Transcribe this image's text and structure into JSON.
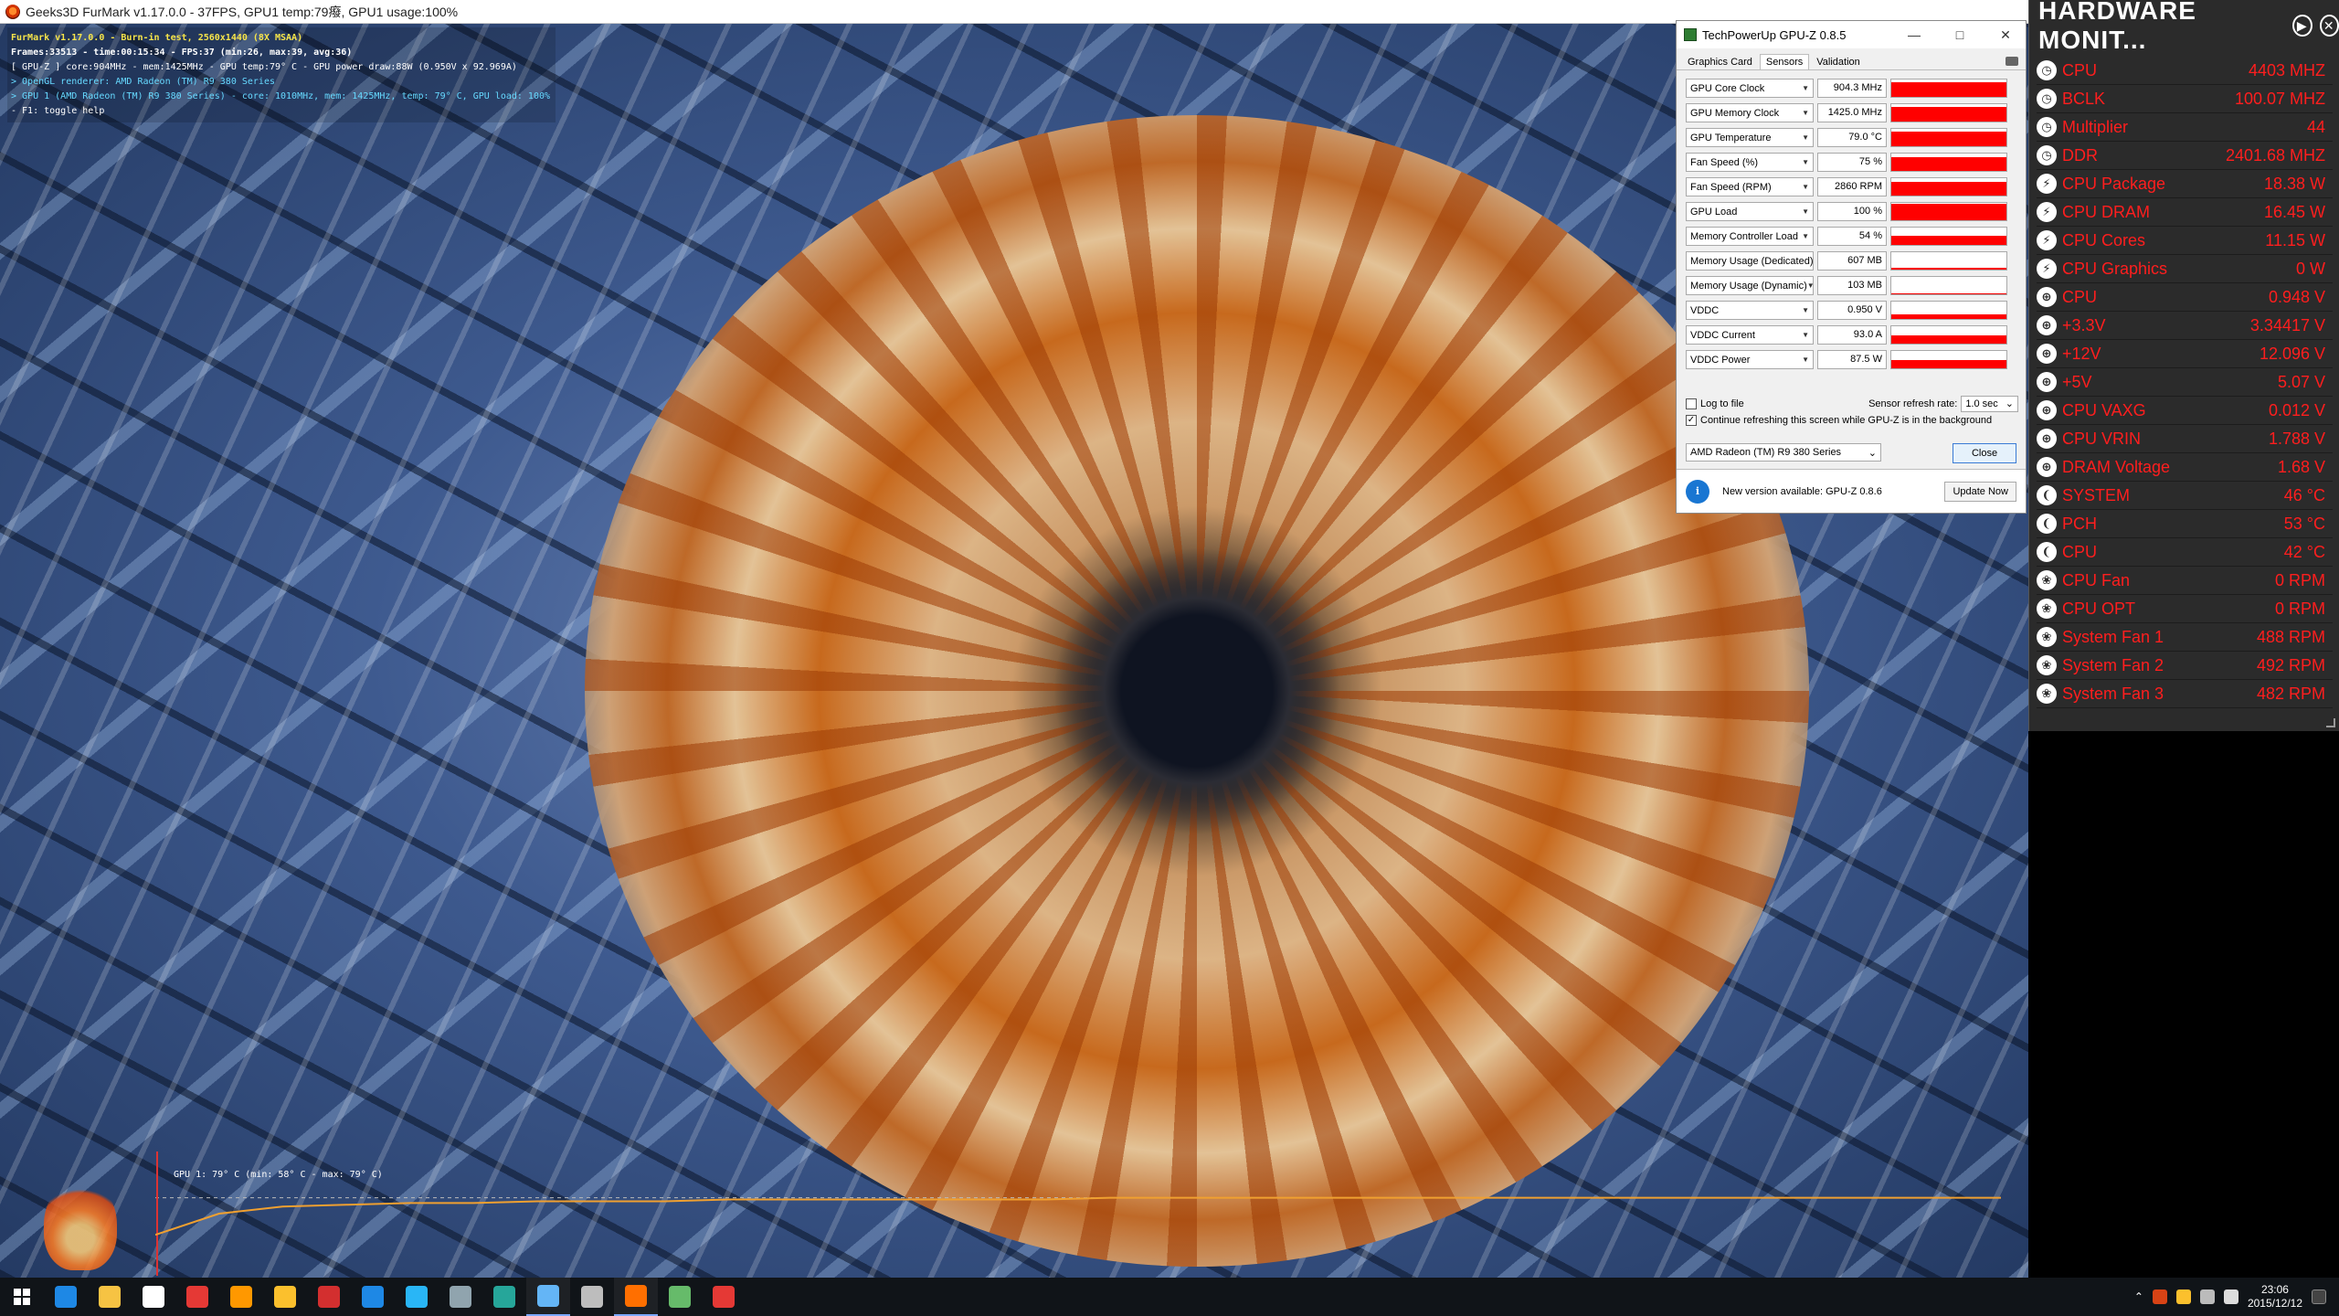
{
  "furmark": {
    "title": "Geeks3D FurMark v1.17.0.0 - 37FPS, GPU1 temp:79癈, GPU1 usage:100%",
    "osd": [
      "FurMark v1.17.0.0 - Burn-in test, 2560x1440 (8X MSAA)",
      "Frames:33513 - time:00:15:34 - FPS:37 (min:26, max:39, avg:36)",
      "[ GPU-Z ] core:904MHz - mem:1425MHz - GPU temp:79° C - GPU power draw:88W (0.950V x 92.969A)",
      "> OpenGL renderer: AMD Radeon (TM) R9 380 Series",
      "> GPU 1 (AMD Radeon (TM) R9 380 Series) - core: 1010MHz, mem: 1425MHz, temp: 79° C, GPU load: 100%",
      "- F1: toggle help"
    ],
    "graph_label": "GPU 1: 79° C (min: 58° C - max: 79° C)",
    "graph_color": "#f0a030",
    "temp_series": [
      58,
      70,
      74,
      75,
      76,
      76,
      77,
      77,
      77,
      78,
      78,
      78,
      78,
      78,
      78,
      79,
      79,
      79,
      79,
      79,
      79,
      79,
      79,
      79,
      79,
      79,
      79,
      79,
      79,
      79
    ]
  },
  "gpuz": {
    "title": "TechPowerUp GPU-Z 0.8.5",
    "tabs": [
      "Graphics Card",
      "Sensors",
      "Validation"
    ],
    "active_tab": "Sensors",
    "sensors": [
      {
        "name": "GPU Core Clock",
        "value": "904.3 MHz",
        "level": 0.85
      },
      {
        "name": "GPU Memory Clock",
        "value": "1425.0 MHz",
        "level": 0.85
      },
      {
        "name": "GPU Temperature",
        "value": "79.0 °C",
        "level": 0.85
      },
      {
        "name": "Fan Speed (%)",
        "value": "75 %",
        "level": 0.8
      },
      {
        "name": "Fan Speed (RPM)",
        "value": "2860 RPM",
        "level": 0.8
      },
      {
        "name": "GPU Load",
        "value": "100 %",
        "level": 0.95
      },
      {
        "name": "Memory Controller Load",
        "value": "54 %",
        "level": 0.55
      },
      {
        "name": "Memory Usage (Dedicated)",
        "value": "607 MB",
        "level": 0.12
      },
      {
        "name": "Memory Usage (Dynamic)",
        "value": "103 MB",
        "level": 0.05
      },
      {
        "name": "VDDC",
        "value": "0.950 V",
        "level": 0.25
      },
      {
        "name": "VDDC Current",
        "value": "93.0 A",
        "level": 0.5
      },
      {
        "name": "VDDC Power",
        "value": "87.5 W",
        "level": 0.5
      }
    ],
    "log_to_file": "Log to file",
    "continue_refresh": "Continue refreshing this screen while GPU-Z is in the background",
    "refresh_label": "Sensor refresh rate:",
    "refresh_value": "1.0 sec",
    "device": "AMD Radeon (TM) R9 380 Series",
    "close_label": "Close",
    "notice": "New version available: GPU-Z 0.8.6",
    "update_label": "Update Now"
  },
  "hwmon": {
    "title": "HARDWARE MONIT...",
    "rows": [
      {
        "label": "CPU",
        "value": "4403 MHZ",
        "icon": "clock"
      },
      {
        "label": "BCLK",
        "value": "100.07 MHZ",
        "icon": "clock"
      },
      {
        "label": "Multiplier",
        "value": "44",
        "icon": "clock"
      },
      {
        "label": "DDR",
        "value": "2401.68 MHZ",
        "icon": "clock"
      },
      {
        "label": "CPU Package",
        "value": "18.38 W",
        "icon": "power"
      },
      {
        "label": "CPU DRAM",
        "value": "16.45 W",
        "icon": "power"
      },
      {
        "label": "CPU Cores",
        "value": "11.15 W",
        "icon": "power"
      },
      {
        "label": "CPU Graphics",
        "value": "0 W",
        "icon": "power"
      },
      {
        "label": "CPU",
        "value": "0.948 V",
        "icon": "voltage"
      },
      {
        "label": "+3.3V",
        "value": "3.34417 V",
        "icon": "voltage"
      },
      {
        "label": "+12V",
        "value": "12.096 V",
        "icon": "voltage"
      },
      {
        "label": "+5V",
        "value": "5.07 V",
        "icon": "voltage"
      },
      {
        "label": "CPU VAXG",
        "value": "0.012 V",
        "icon": "voltage"
      },
      {
        "label": "CPU VRIN",
        "value": "1.788 V",
        "icon": "voltage"
      },
      {
        "label": "DRAM Voltage",
        "value": "1.68 V",
        "icon": "voltage"
      },
      {
        "label": "SYSTEM",
        "value": "46 °C",
        "icon": "temp"
      },
      {
        "label": "PCH",
        "value": "53 °C",
        "icon": "temp"
      },
      {
        "label": "CPU",
        "value": "42 °C",
        "icon": "temp"
      },
      {
        "label": "CPU Fan",
        "value": "0 RPM",
        "icon": "fan"
      },
      {
        "label": "CPU OPT",
        "value": "0 RPM",
        "icon": "fan"
      },
      {
        "label": "System Fan 1",
        "value": "488 RPM",
        "icon": "fan"
      },
      {
        "label": "System Fan 2",
        "value": "492 RPM",
        "icon": "fan"
      },
      {
        "label": "System Fan 3",
        "value": "482 RPM",
        "icon": "fan"
      }
    ]
  },
  "taskbar": {
    "apps": [
      {
        "name": "edge",
        "color": "#1e88e5"
      },
      {
        "name": "file-explorer",
        "color": "#f6c343"
      },
      {
        "name": "store",
        "color": "#ffffff"
      },
      {
        "name": "app-red",
        "color": "#e53935"
      },
      {
        "name": "app-cat",
        "color": "#ff9800"
      },
      {
        "name": "chrome",
        "color": "#fbc02d"
      },
      {
        "name": "app-circle-red",
        "color": "#d32f2f"
      },
      {
        "name": "app-blue",
        "color": "#1e88e5"
      },
      {
        "name": "app-bird",
        "color": "#29b6f6"
      },
      {
        "name": "app-shield",
        "color": "#90a4ae"
      },
      {
        "name": "app-terminal",
        "color": "#26a69a"
      },
      {
        "name": "app-gpuz",
        "color": "#64b5f6"
      },
      {
        "name": "app-photo",
        "color": "#bdbdbd"
      },
      {
        "name": "furmark",
        "color": "#ff6f00"
      },
      {
        "name": "app-green",
        "color": "#66bb6a"
      },
      {
        "name": "app-red-dot",
        "color": "#e53935"
      }
    ],
    "time": "23:06",
    "date": "2015/12/12"
  }
}
